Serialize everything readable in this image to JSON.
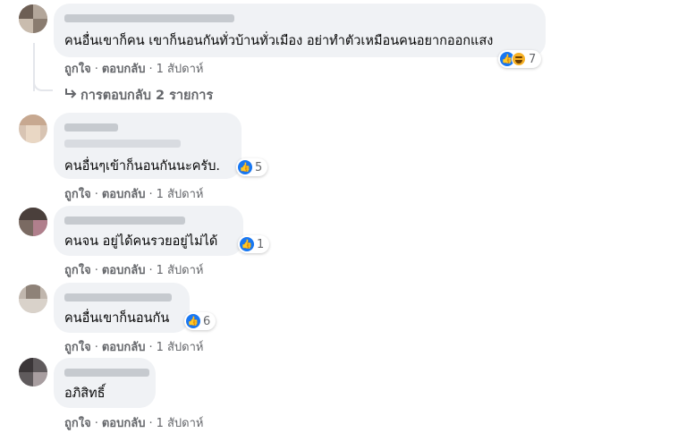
{
  "actions": {
    "like": "ถูกใจ",
    "reply": "ตอบกลับ",
    "time": "1 สัปดาห์",
    "sep": "·"
  },
  "colors": {
    "bubble": "#f0f2f5",
    "like_blue": "#1877f2",
    "meta_grey": "#65676b"
  },
  "comments": [
    {
      "text": "คนอื่นเขาก็คน เขาก็นอนกันทั่วบ้านทั่วเมือง อย่าทำตัวเหมือนคนอยากออกแสง",
      "reactions": [
        "like",
        "haha"
      ],
      "count": "7"
    },
    {
      "text": "คนอื่นๆเข้าก็นอนกันนะครับ.",
      "reactions": [
        "like"
      ],
      "count": "5"
    },
    {
      "text": "คนจน อยู่ได้คนรวยอยู่ไม่ได้",
      "reactions": [
        "like"
      ],
      "count": "1"
    },
    {
      "text": "คนอื่นเขาก็นอนกัน",
      "reactions": [
        "like"
      ],
      "count": "6"
    },
    {
      "text": "อภิสิทธิ์",
      "reactions": [],
      "count": ""
    }
  ],
  "replies_link": {
    "arrow_icon": "reply-arrow-icon",
    "label": "การตอบกลับ 2 รายการ"
  }
}
